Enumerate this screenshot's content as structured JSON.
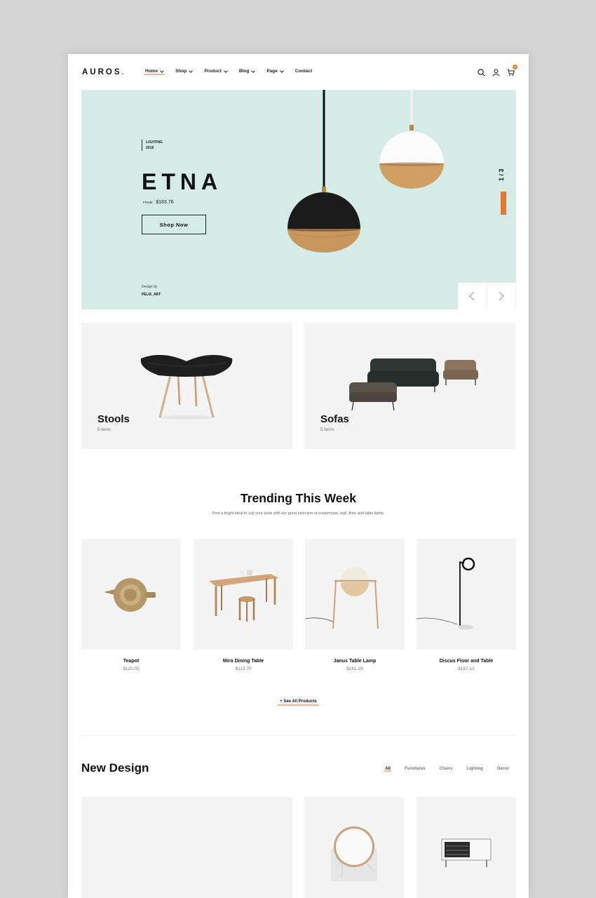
{
  "header": {
    "logo_text": "AUROS",
    "logo_dot": ".",
    "nav": [
      {
        "label": "Home",
        "has_dropdown": true
      },
      {
        "label": "Shop",
        "has_dropdown": true
      },
      {
        "label": "Product",
        "has_dropdown": true
      },
      {
        "label": "Blog",
        "has_dropdown": true
      },
      {
        "label": "Page",
        "has_dropdown": true
      },
      {
        "label": "Contact",
        "has_dropdown": false
      }
    ],
    "icons": [
      "search-icon",
      "user-icon",
      "cart-icon"
    ],
    "cart_count": "0"
  },
  "hero": {
    "category_line1": "LIGHTING",
    "category_line2": "2018",
    "title": "ETNA",
    "price_from": "FROM",
    "price": "$183.76",
    "button_label": "Shop Now",
    "credit_label": "Design by",
    "credit_name": "FELIX_ART",
    "slide_counter": "1 / 3",
    "background_color": "#d4ebe6",
    "accent_color": "#e8772e"
  },
  "categories": [
    {
      "name": "Stools",
      "count": "5 items"
    },
    {
      "name": "Sofas",
      "count": "5 items"
    }
  ],
  "trending": {
    "title": "Trending This Week",
    "subtitle": "Find a bright ideal to suit your taste with our great selection of suspension, wall, floor and table lights.",
    "products": [
      {
        "name": "Teapot",
        "price": "$120.05"
      },
      {
        "name": "Miro Dining Table",
        "price": "$113.70"
      },
      {
        "name": "Janus Table Lamp",
        "price": "$161.29"
      },
      {
        "name": "Discus Floor and Table",
        "price": "$167.12"
      }
    ],
    "see_all_label": "+ See All Products"
  },
  "new_design": {
    "title": "New Design",
    "tabs": [
      {
        "label": "All",
        "active": true
      },
      {
        "label": "Furnitures",
        "active": false
      },
      {
        "label": "Chairs",
        "active": false
      },
      {
        "label": "Lighting",
        "active": false
      },
      {
        "label": "Decor",
        "active": false
      }
    ]
  }
}
